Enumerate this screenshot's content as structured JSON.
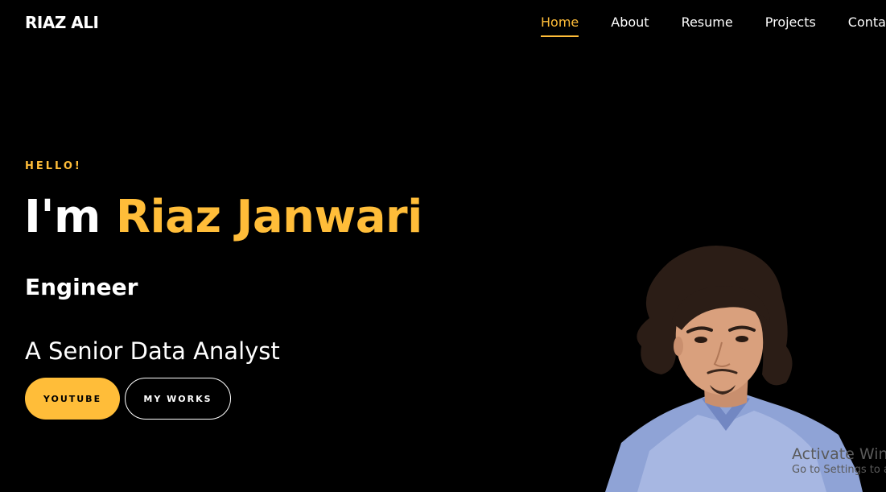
{
  "brand": {
    "logo_text": "RIAZ ALI"
  },
  "nav": {
    "items": [
      {
        "label": "Home",
        "active": true
      },
      {
        "label": "About",
        "active": false
      },
      {
        "label": "Resume",
        "active": false
      },
      {
        "label": "Projects",
        "active": false
      },
      {
        "label": "Contact",
        "active": false
      }
    ]
  },
  "hero": {
    "greeting": "HELLO!",
    "intro": "I'm",
    "name": "Riaz Janwari",
    "role": "Engineer",
    "tagline": "A Senior Data Analyst",
    "buttons": {
      "primary": "YOUTUBE",
      "secondary": "MY WORKS"
    }
  },
  "os_watermark": {
    "line1": "Activate Windows",
    "line2": "Go to Settings to activate Windows."
  },
  "colors": {
    "background": "#000000",
    "accent": "#ffbd39",
    "text": "#ffffff"
  }
}
